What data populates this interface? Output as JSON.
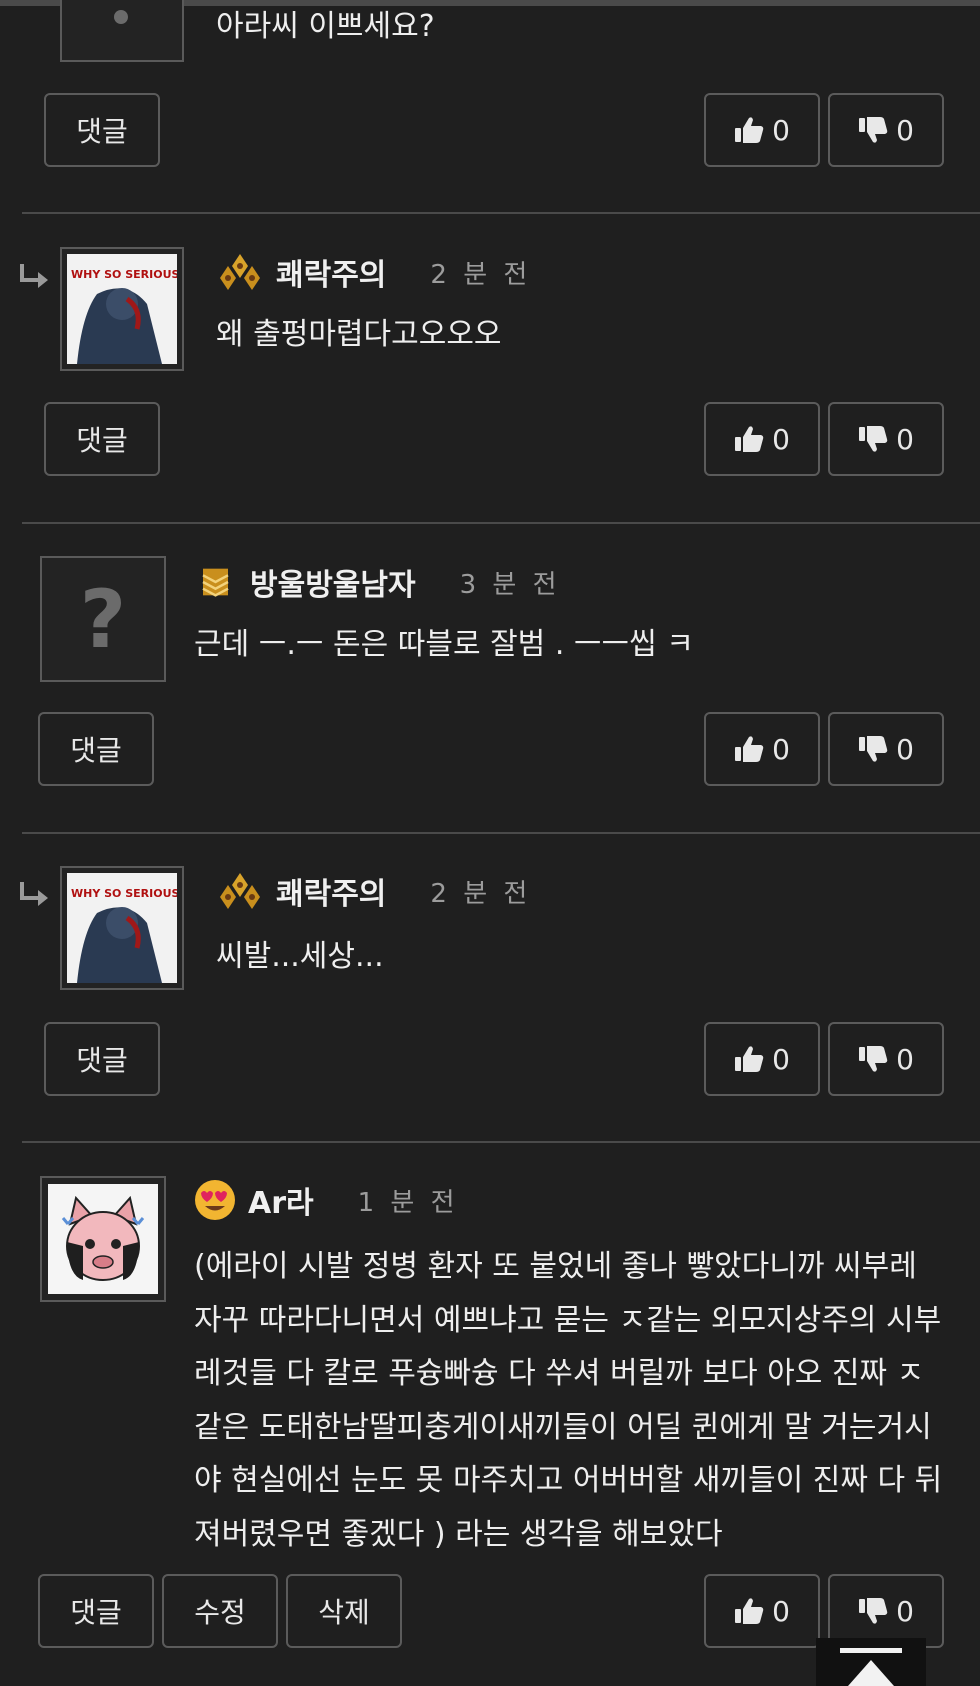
{
  "comments": [
    {
      "text": "아라씨 이쁘세요?",
      "buttons": {
        "reply": "댓글",
        "like": "0",
        "dislike": "0"
      }
    },
    {
      "nick": "쾌락주의",
      "time": "2 분 전",
      "avatar_text": "WHY SO SERIOUS?",
      "text": "왜 출펑마렵다고오오오",
      "buttons": {
        "reply": "댓글",
        "like": "0",
        "dislike": "0"
      }
    },
    {
      "nick": "방울방울남자",
      "time": "3 분 전",
      "text": "근데 ㅡ.ㅡ 돈은 따블로 잘범 . ㅡㅡ씹 ㅋ",
      "buttons": {
        "reply": "댓글",
        "like": "0",
        "dislike": "0"
      }
    },
    {
      "nick": "쾌락주의",
      "time": "2 분 전",
      "avatar_text": "WHY SO SERIOUS?",
      "text": "씨발...세상...",
      "buttons": {
        "reply": "댓글",
        "like": "0",
        "dislike": "0"
      }
    },
    {
      "nick": "Ar라",
      "time": "1 분 전",
      "text_lines": [
        "(에라이 시발 정병 환자 또 붙었네 좋나 빻았다니까 씨부레",
        "자꾸 따라다니면서 예쁘냐고 묻는 ㅈ같는 외모지상주의 시부",
        "레것들 다 칼로 푸슝빠슝 다 쑤셔 버릴까 보다 아오 진짜 ㅈ",
        "같은 도태한남딸피충게이새끼들이 어딜 퀸에게 말 거는거시",
        "야 현실에선 눈도 못 마주치고 어버버할 새끼들이 진짜 다 뒤",
        "져버렸우면 좋겠다 ) 라는 생각을 해보았다"
      ],
      "buttons": {
        "reply": "댓글",
        "edit": "수정",
        "delete": "삭제",
        "like": "0",
        "dislike": "0"
      }
    }
  ],
  "colors": {
    "background": "#1f1f1f",
    "border": "#5b5b5b",
    "separator": "#4a4a4a",
    "time": "#9c9c9c"
  },
  "icons": [
    "reply-arrow-icon",
    "thumbs-up-icon",
    "thumbs-down-icon",
    "level-badge-icon",
    "emoji-heart-eyes-icon",
    "scroll-to-top-icon"
  ]
}
